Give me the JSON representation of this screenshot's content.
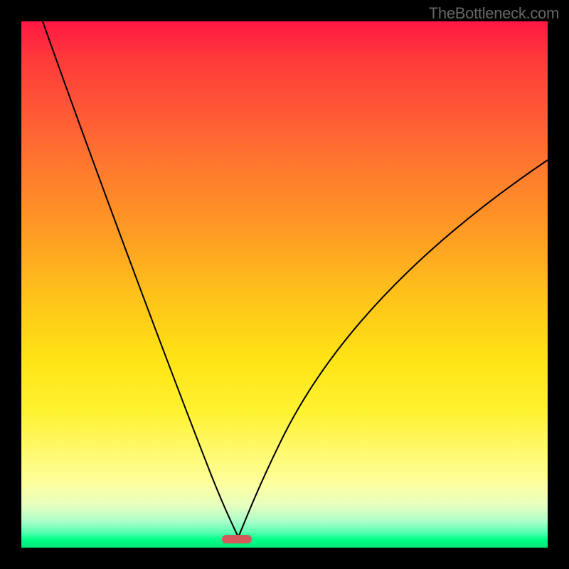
{
  "watermark": "TheBottleneck.com",
  "chart_data": {
    "type": "line",
    "title": "",
    "xlabel": "",
    "ylabel": "",
    "xlim": [
      0,
      1
    ],
    "ylim": [
      0,
      1
    ],
    "x": [
      0.0,
      0.05,
      0.1,
      0.15,
      0.2,
      0.25,
      0.3,
      0.35,
      0.4,
      0.41,
      0.42,
      0.45,
      0.5,
      0.55,
      0.6,
      0.65,
      0.7,
      0.75,
      0.8,
      0.85,
      0.9,
      0.95,
      1.0
    ],
    "values": [
      1.0,
      0.88,
      0.76,
      0.64,
      0.52,
      0.4,
      0.28,
      0.16,
      0.04,
      0.02,
      0.04,
      0.1,
      0.19,
      0.27,
      0.34,
      0.41,
      0.47,
      0.53,
      0.58,
      0.63,
      0.67,
      0.71,
      0.74
    ],
    "min_x": 0.41,
    "marker_color": "#d45a5a",
    "curve_color": "#000000",
    "background_gradient": {
      "top": "#ff1744",
      "mid": "#ffeb3b",
      "bottom": "#00e676"
    }
  }
}
